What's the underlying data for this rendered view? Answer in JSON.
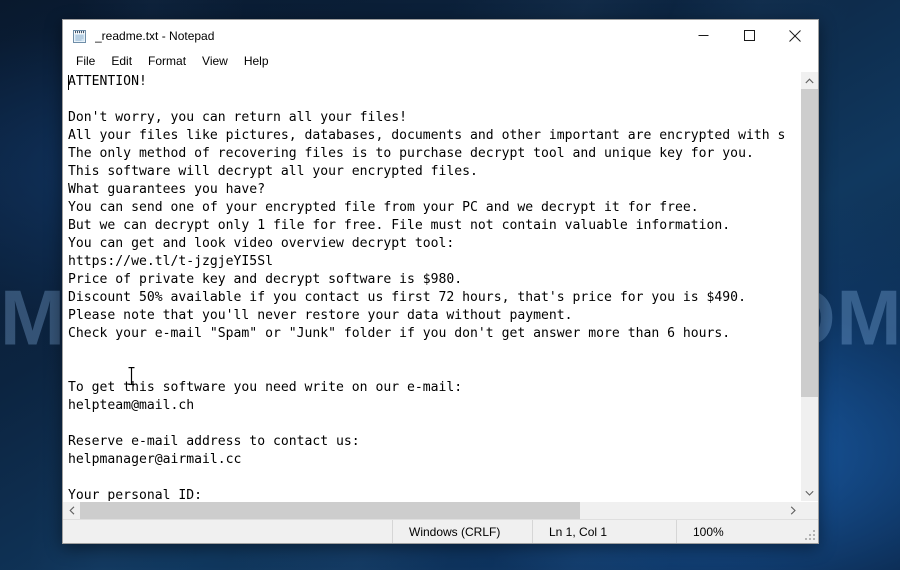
{
  "desktop": {
    "watermark": "MYANTISPYWARE.COM"
  },
  "window": {
    "title": "_readme.txt - Notepad",
    "icon": "notepad-icon",
    "controls": {
      "minimize": "Minimize",
      "maximize": "Maximize",
      "close": "Close"
    }
  },
  "menubar": {
    "items": [
      {
        "label": "File"
      },
      {
        "label": "Edit"
      },
      {
        "label": "Format"
      },
      {
        "label": "View"
      },
      {
        "label": "Help"
      }
    ]
  },
  "editor": {
    "content": "ATTENTION!\n\nDon't worry, you can return all your files!\nAll your files like pictures, databases, documents and other important are encrypted with s\nThe only method of recovering files is to purchase decrypt tool and unique key for you.\nThis software will decrypt all your encrypted files.\nWhat guarantees you have?\nYou can send one of your encrypted file from your PC and we decrypt it for free.\nBut we can decrypt only 1 file for free. File must not contain valuable information.\nYou can get and look video overview decrypt tool:\nhttps://we.tl/t-jzgjeYI5Sl\nPrice of private key and decrypt software is $980.\nDiscount 50% available if you contact us first 72 hours, that's price for you is $490.\nPlease note that you'll never restore your data without payment.\nCheck your e-mail \"Spam\" or \"Junk\" folder if you don't get answer more than 6 hours.\n\n\nTo get this software you need write on our e-mail:\nhelpteam@mail.ch\n\nReserve e-mail address to contact us:\nhelpmanager@airmail.cc\n\nYour personal ID:",
    "scroll": {
      "vertical_thumb_percent": 78,
      "horizontal_thumb_percent": 71
    }
  },
  "statusbar": {
    "encoding": "Windows (CRLF)",
    "position": "Ln 1, Col 1",
    "zoom": "100%"
  }
}
